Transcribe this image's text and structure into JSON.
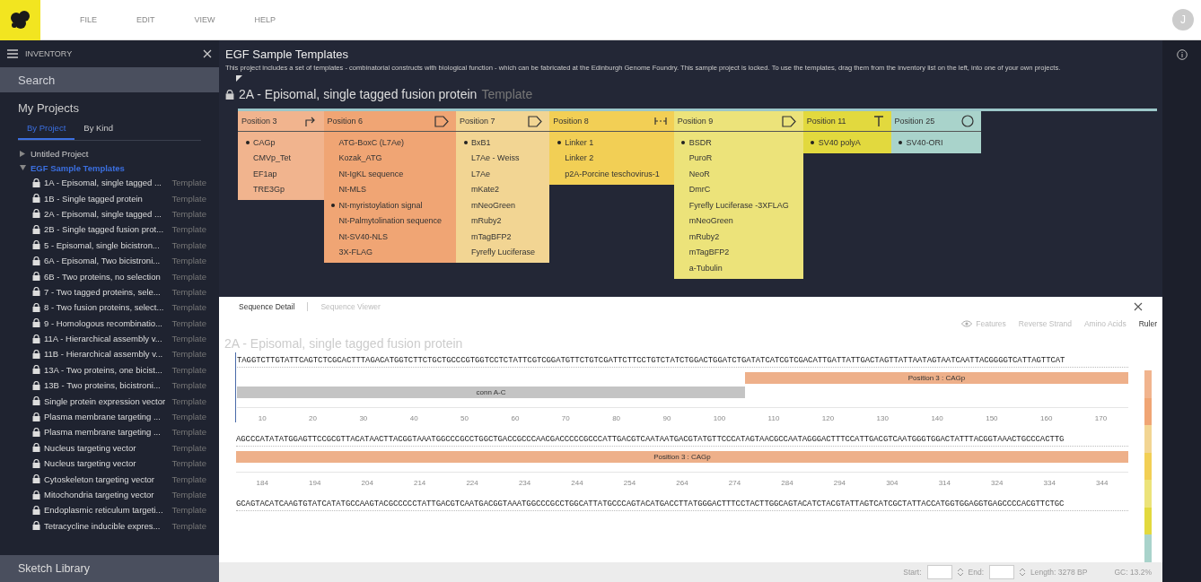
{
  "menu": [
    "FILE",
    "EDIT",
    "VIEW",
    "HELP"
  ],
  "avatar": "J",
  "inventory": {
    "title": "INVENTORY",
    "search": {
      "placeholder": "Search"
    },
    "section": "My Projects",
    "tabs": [
      {
        "label": "By Project",
        "selected": true
      },
      {
        "label": "By Kind",
        "selected": false
      }
    ],
    "tree": [
      {
        "label": "Untitled Project",
        "expanded": false,
        "selected": false
      },
      {
        "label": "EGF Sample Templates",
        "expanded": true,
        "selected": true,
        "children": [
          {
            "label": "1A - Episomal, single tagged ...",
            "tag": "Template"
          },
          {
            "label": "1B - Single tagged protein",
            "tag": "Template"
          },
          {
            "label": "2A - Episomal, single tagged ...",
            "tag": "Template"
          },
          {
            "label": "2B - Single tagged fusion prot...",
            "tag": "Template"
          },
          {
            "label": "5 - Episomal, single bicistron...",
            "tag": "Template"
          },
          {
            "label": "6A - Episomal, Two bicistroni...",
            "tag": "Template"
          },
          {
            "label": "6B - Two proteins, no selection",
            "tag": "Template"
          },
          {
            "label": "7 - Two tagged proteins, sele...",
            "tag": "Template"
          },
          {
            "label": "8 - Two fusion proteins, select...",
            "tag": "Template"
          },
          {
            "label": "9 - Homologous recombinatio...",
            "tag": "Template"
          },
          {
            "label": "11A - Hierarchical assembly v...",
            "tag": "Template"
          },
          {
            "label": "11B - Hierarchical assembly v...",
            "tag": "Template"
          },
          {
            "label": "13A - Two proteins, one bicist...",
            "tag": "Template"
          },
          {
            "label": "13B - Two proteins, bicistroni...",
            "tag": "Template"
          },
          {
            "label": "Single protein expression vector",
            "tag": "Template"
          },
          {
            "label": "Plasma membrane targeting ...",
            "tag": "Template"
          },
          {
            "label": "Plasma membrane targeting ...",
            "tag": "Template"
          },
          {
            "label": "Nucleus targeting vector",
            "tag": "Template"
          },
          {
            "label": "Nucleus targeting vector",
            "tag": "Template"
          },
          {
            "label": "Cytoskeleton targeting vector",
            "tag": "Template"
          },
          {
            "label": "Mitochondria targeting vector",
            "tag": "Template"
          },
          {
            "label": "Endoplasmic reticulum targeti...",
            "tag": "Template"
          },
          {
            "label": "Tetracycline inducible expres...",
            "tag": "Template"
          }
        ]
      }
    ],
    "footer": "Sketch Library"
  },
  "project": {
    "title": "EGF Sample Templates",
    "description": "This project includes a set of templates - combinatorial constructs with biological function - which can be fabricated at the Edinburgh Genome Foundry. This sample project is locked. To use the templates, drag them from the inventory list on the left, into one of your own projects."
  },
  "construct": {
    "title": "2A - Episomal, single tagged fusion protein",
    "tag": "Template",
    "positions": [
      {
        "name": "Position 3",
        "kind": "promoter",
        "color": "#f1b48e",
        "parts": [
          {
            "label": "CAGp",
            "selected": true
          },
          {
            "label": "CMVp_Tet",
            "selected": false
          },
          {
            "label": "EF1ap",
            "selected": false
          },
          {
            "label": "TRE3Gp",
            "selected": false
          }
        ]
      },
      {
        "name": "Position 6",
        "kind": "cds",
        "color": "#f0a574",
        "parts": [
          {
            "label": "ATG-BoxC (L7Ae)",
            "selected": false
          },
          {
            "label": "Kozak_ATG",
            "selected": false
          },
          {
            "label": "Nt-IgKL sequence",
            "selected": false
          },
          {
            "label": "Nt-MLS",
            "selected": false
          },
          {
            "label": "Nt-myristoylation signal",
            "selected": true
          },
          {
            "label": "Nt-Palmytolination sequence",
            "selected": false
          },
          {
            "label": "Nt-SV40-NLS",
            "selected": false
          },
          {
            "label": "3X-FLAG",
            "selected": false
          }
        ]
      },
      {
        "name": "Position 7",
        "kind": "cds",
        "color": "#f2d593",
        "parts": [
          {
            "label": "BxB1",
            "selected": true
          },
          {
            "label": "L7Ae - Weiss",
            "selected": false
          },
          {
            "label": "L7Ae",
            "selected": false
          },
          {
            "label": "mKate2",
            "selected": false
          },
          {
            "label": "mNeoGreen",
            "selected": false
          },
          {
            "label": "mRuby2",
            "selected": false
          },
          {
            "label": "mTagBFP2",
            "selected": false
          },
          {
            "label": "Fyrefly Luciferase",
            "selected": false
          }
        ]
      },
      {
        "name": "Position 8",
        "kind": "linker",
        "color": "#f2cf55",
        "parts": [
          {
            "label": "Linker 1",
            "selected": true
          },
          {
            "label": "Linker 2",
            "selected": false
          },
          {
            "label": "p2A-Porcine teschovirus-1",
            "selected": false
          }
        ]
      },
      {
        "name": "Position 9",
        "kind": "cds",
        "color": "#ece37a",
        "parts": [
          {
            "label": "BSDR",
            "selected": true
          },
          {
            "label": "PuroR",
            "selected": false
          },
          {
            "label": "NeoR",
            "selected": false
          },
          {
            "label": "DmrC",
            "selected": false
          },
          {
            "label": "Fyrefly Luciferase -3XFLAG",
            "selected": false
          },
          {
            "label": "mNeoGreen",
            "selected": false
          },
          {
            "label": "mRuby2",
            "selected": false
          },
          {
            "label": "mTagBFP2",
            "selected": false
          },
          {
            "label": "a-Tubulin",
            "selected": false
          }
        ]
      },
      {
        "name": "Position 11",
        "kind": "terminator",
        "color": "#e2d93e",
        "parts": [
          {
            "label": "SV40 polyA",
            "selected": true
          }
        ]
      },
      {
        "name": "Position 25",
        "kind": "origin",
        "color": "#a9d3cb",
        "parts": [
          {
            "label": "SV40-ORI",
            "selected": true
          }
        ]
      }
    ]
  },
  "sequence": {
    "tabs": [
      {
        "label": "Sequence Detail",
        "selected": true
      },
      {
        "label": "Sequence Viewer",
        "selected": false
      }
    ],
    "options": [
      {
        "label": "Features",
        "on": false,
        "kind": "eye"
      },
      {
        "label": "Reverse Strand",
        "on": false,
        "kind": "plain"
      },
      {
        "label": "Amino Acids",
        "on": false,
        "kind": "plain"
      },
      {
        "label": "Ruler",
        "on": true,
        "kind": "plain"
      }
    ],
    "title": "2A - Episomal, single tagged fusion protein",
    "rows": [
      {
        "bases": "TAGGTCTTGTATTCAGTCTCGCACTTTAGACATGGTCTTCTGCTGCCCGTGGTCCTCTATTCGTCGGATGTTCTGTCGATTCTTCCTGTCTATCTGGACTGGATCTGATATCATCGTCGACATTGATTATTGACTAGTTATTAATAGTAATCAATTACGGGGTCATTAGTTCAT",
        "cursor": true,
        "lanes": [
          [
            {
              "label": "Position 3 : CAGp",
              "color": "#eeb08a",
              "kind": "end",
              "level": 0.43
            }
          ],
          [
            {
              "label": "conn A-C",
              "color": "#c4c4c4",
              "kind": "start",
              "level": 0.57
            }
          ]
        ],
        "ticks": [
          "10",
          "20",
          "30",
          "40",
          "50",
          "60",
          "70",
          "80",
          "90",
          "100",
          "110",
          "120",
          "130",
          "140",
          "150",
          "160",
          "170"
        ]
      },
      {
        "bases": "AGCCCATATATGGAGTTCCGCGTTACATAACTTACGGTAAATGGCCCGCCTGGCTGACCGCCCAACGACCCCCGCCCATTGACGTCAATAATGACGTATGTTCCCATAGTAACGCCAATAGGGACTTTCCATTGACGTCAATGGGTGGACTATTTACGGTAAACTGCCCACTTG",
        "cursor": false,
        "lanes": [
          [
            {
              "label": "Position 3 : CAGp",
              "color": "#eeb08a",
              "kind": "start",
              "level": 1
            }
          ]
        ],
        "ticks": [
          "184",
          "194",
          "204",
          "214",
          "224",
          "234",
          "244",
          "254",
          "264",
          "274",
          "284",
          "294",
          "304",
          "314",
          "324",
          "334",
          "344"
        ]
      },
      {
        "bases": "GCAGTACATCAAGTGTATCATATGCCAAGTACGCCCCCTATTGACGTCAATGACGGTAAATGGCCCGCCTGGCATTATGCCCAGTACATGACCTTATGGGACTTTCCTACTTGGCAGTACATCTACGTATTAGTCATCGCTATTACCATGGTGGAGGTGAGCCCCACGTTCTGC",
        "cursor": false,
        "lanes": [],
        "ticks": []
      }
    ],
    "status": {
      "start_label": "Start:",
      "end_label": "End:",
      "length": "Length: 3278 BP",
      "gc": "GC: 13.2%"
    }
  }
}
